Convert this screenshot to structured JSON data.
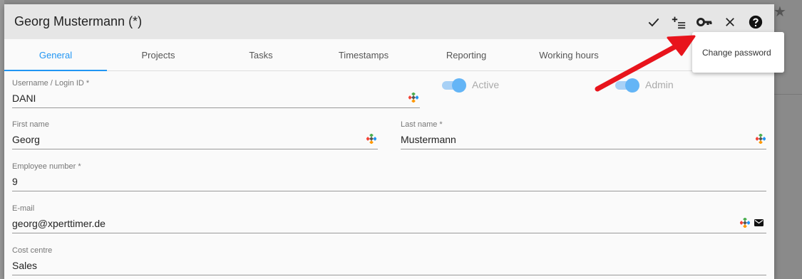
{
  "dialog": {
    "title": "Georg Mustermann (*)"
  },
  "header_actions": {
    "save": "check-icon",
    "add_list": "add-list-icon",
    "change_password": "key-icon",
    "close": "close-icon",
    "help": "help-icon"
  },
  "tabs": [
    {
      "label": "General",
      "active": true
    },
    {
      "label": "Projects",
      "active": false
    },
    {
      "label": "Tasks",
      "active": false
    },
    {
      "label": "Timestamps",
      "active": false
    },
    {
      "label": "Reporting",
      "active": false
    },
    {
      "label": "Working hours",
      "active": false
    }
  ],
  "tooltip": {
    "text": "Change password"
  },
  "form": {
    "username": {
      "label": "Username / Login ID *",
      "value": "DANI"
    },
    "active": {
      "label": "Active",
      "checked": true
    },
    "admin": {
      "label": "Admin",
      "checked": true
    },
    "first_name": {
      "label": "First name",
      "value": "Georg"
    },
    "last_name": {
      "label": "Last name *",
      "value": "Mustermann"
    },
    "employee_number": {
      "label": "Employee number *",
      "value": "9"
    },
    "email": {
      "label": "E-mail",
      "value": "georg@xperttimer.de"
    },
    "cost_centre": {
      "label": "Cost centre",
      "value": "Sales"
    }
  },
  "colors": {
    "accent": "#2196f3",
    "arrow": "#e8141c",
    "header_bg": "#e6e6e6"
  }
}
